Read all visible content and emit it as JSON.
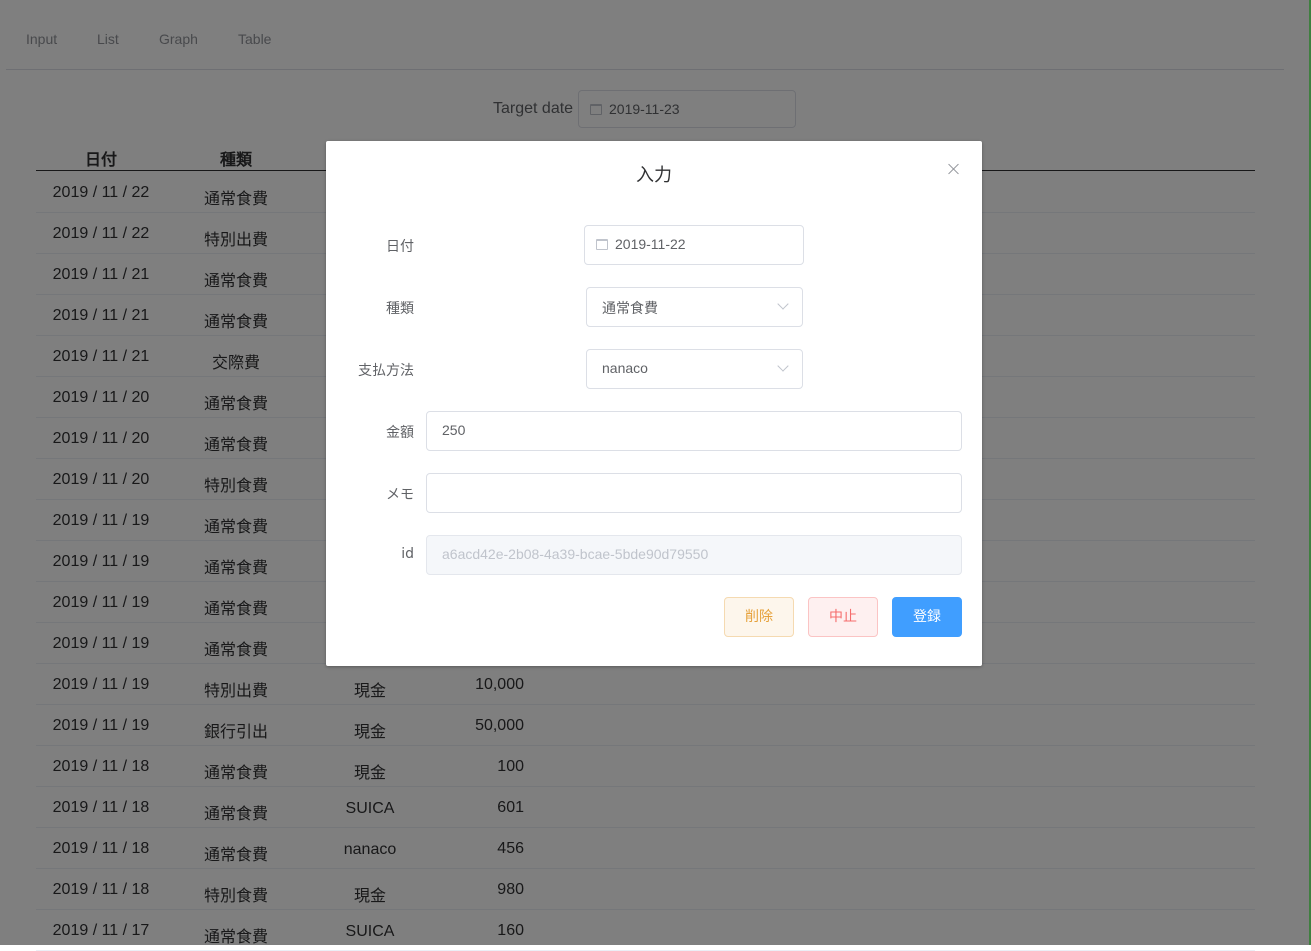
{
  "nav": {
    "items": [
      "Input",
      "List",
      "Graph",
      "Table"
    ]
  },
  "filter": {
    "label": "Target date",
    "value": "2019-11-23"
  },
  "table": {
    "headers": {
      "date": "日付",
      "kind": "種類"
    },
    "rows": [
      {
        "date": "2019 / 11 / 22",
        "kind": "通常食費",
        "pay": "",
        "amount": ""
      },
      {
        "date": "2019 / 11 / 22",
        "kind": "特別出費",
        "pay": "",
        "amount": ""
      },
      {
        "date": "2019 / 11 / 21",
        "kind": "通常食費",
        "pay": "",
        "amount": ""
      },
      {
        "date": "2019 / 11 / 21",
        "kind": "通常食費",
        "pay": "",
        "amount": ""
      },
      {
        "date": "2019 / 11 / 21",
        "kind": "交際費",
        "pay": "",
        "amount": ""
      },
      {
        "date": "2019 / 11 / 20",
        "kind": "通常食費",
        "pay": "",
        "amount": ""
      },
      {
        "date": "2019 / 11 / 20",
        "kind": "通常食費",
        "pay": "",
        "amount": ""
      },
      {
        "date": "2019 / 11 / 20",
        "kind": "特別食費",
        "pay": "",
        "amount": ""
      },
      {
        "date": "2019 / 11 / 19",
        "kind": "通常食費",
        "pay": "",
        "amount": ""
      },
      {
        "date": "2019 / 11 / 19",
        "kind": "通常食費",
        "pay": "",
        "amount": ""
      },
      {
        "date": "2019 / 11 / 19",
        "kind": "通常食費",
        "pay": "",
        "amount": ""
      },
      {
        "date": "2019 / 11 / 19",
        "kind": "通常食費",
        "pay": "",
        "amount": ""
      },
      {
        "date": "2019 / 11 / 19",
        "kind": "特別出費",
        "pay": "現金",
        "amount": "10,000"
      },
      {
        "date": "2019 / 11 / 19",
        "kind": "銀行引出",
        "pay": "現金",
        "amount": "50,000"
      },
      {
        "date": "2019 / 11 / 18",
        "kind": "通常食費",
        "pay": "現金",
        "amount": "100"
      },
      {
        "date": "2019 / 11 / 18",
        "kind": "通常食費",
        "pay": "SUICA",
        "amount": "601"
      },
      {
        "date": "2019 / 11 / 18",
        "kind": "通常食費",
        "pay": "nanaco",
        "amount": "456"
      },
      {
        "date": "2019 / 11 / 18",
        "kind": "特別食費",
        "pay": "現金",
        "amount": "980"
      },
      {
        "date": "2019 / 11 / 17",
        "kind": "通常食費",
        "pay": "SUICA",
        "amount": "160"
      }
    ]
  },
  "dialog": {
    "title": "入力",
    "fields": {
      "date": {
        "label": "日付",
        "value": "2019-11-22"
      },
      "kind": {
        "label": "種類",
        "value": "通常食費"
      },
      "payment": {
        "label": "支払方法",
        "value": "nanaco"
      },
      "amount": {
        "label": "金額",
        "value": "250"
      },
      "memo": {
        "label": "メモ",
        "value": ""
      },
      "id": {
        "label": "id",
        "value": "a6acd42e-2b08-4a39-bcae-5bde90d79550"
      }
    },
    "buttons": {
      "delete": "削除",
      "cancel": "中止",
      "save": "登録"
    }
  },
  "colors": {
    "primary": "#409eff",
    "warning": "#e6a23c",
    "danger": "#f56c6c"
  }
}
